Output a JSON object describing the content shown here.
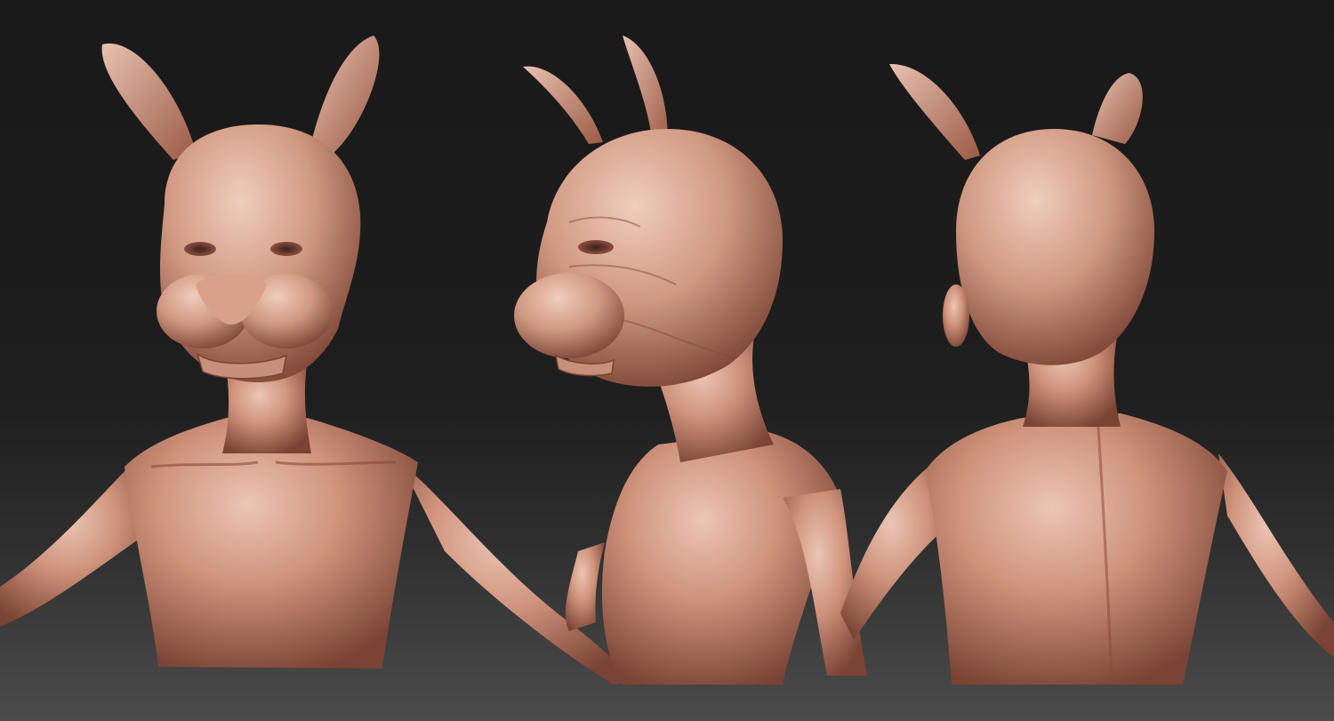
{
  "scene": {
    "background_top": "#191919",
    "background_bottom": "#4c4c4c",
    "clay_base": "#c98a73",
    "clay_light": "#e6bcaa",
    "clay_shadow": "#7a4333",
    "views": [
      {
        "name": "front-view"
      },
      {
        "name": "three-quarter-view"
      },
      {
        "name": "back-view"
      }
    ]
  }
}
